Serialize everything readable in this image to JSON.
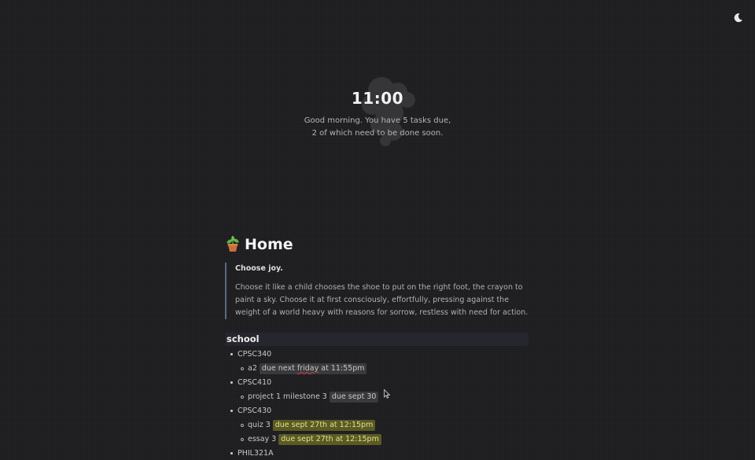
{
  "theme_toggle": {
    "icon": "moon-icon"
  },
  "hero": {
    "time": "11:00",
    "greeting_line1": "Good morning. You have 5 tasks due,",
    "greeting_line2": "2 of which need to be done soon."
  },
  "page": {
    "title": "Home",
    "title_icon": "potted-plant-icon"
  },
  "quote": {
    "heading": "Choose joy.",
    "body": "Choose it like a child chooses the shoe to put on the right foot, the crayon to paint a sky. Choose it at first consciously, effortfully, pressing against the weight of a world heavy with reasons for sorrow, restless with need for action."
  },
  "school": {
    "heading": "school",
    "courses": [
      {
        "name": "CPSC340",
        "tasks": [
          {
            "name": "a2",
            "due_prefix": "due next ",
            "due_underlined": "friday",
            "due_suffix": " at 11:55pm",
            "soon": false
          }
        ]
      },
      {
        "name": "CPSC410",
        "tasks": [
          {
            "name": "project 1 milestone 3",
            "due": "due sept 30",
            "soon": false
          }
        ]
      },
      {
        "name": "CPSC430",
        "tasks": [
          {
            "name": "quiz 3",
            "due": "due sept 27th at 12:15pm",
            "soon": true
          },
          {
            "name": "essay 3",
            "due": "due sept 27th at 12:15pm",
            "soon": true
          }
        ]
      },
      {
        "name": "PHIL321A",
        "tasks": []
      }
    ]
  },
  "colors": {
    "background": "#1d1d20",
    "quote_border": "#5a6a80",
    "due_soon_bg": "#5a5a24",
    "due_soon_text": "#e5e08a",
    "section_bg": "#26262e"
  }
}
